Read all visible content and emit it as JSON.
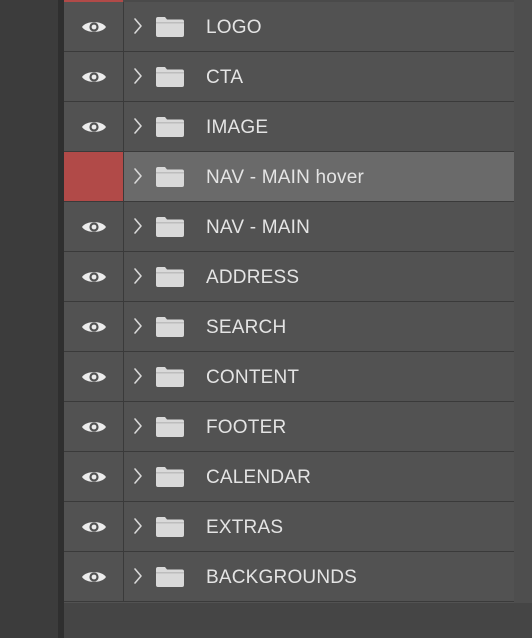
{
  "colors": {
    "panel_bg": "#525252",
    "selected_bg": "#6a6a6a",
    "hidden_marker": "#b14a48",
    "text": "#e4e4e4",
    "divider": "#3a3a3a"
  },
  "layers": [
    {
      "name": "LOGO",
      "visible": true,
      "selected": false,
      "icon": "folder-icon"
    },
    {
      "name": "CTA",
      "visible": true,
      "selected": false,
      "icon": "folder-icon"
    },
    {
      "name": "IMAGE",
      "visible": true,
      "selected": false,
      "icon": "folder-icon"
    },
    {
      "name": "NAV - MAIN hover",
      "visible": false,
      "selected": true,
      "icon": "folder-icon"
    },
    {
      "name": "NAV - MAIN",
      "visible": true,
      "selected": false,
      "icon": "folder-icon"
    },
    {
      "name": "ADDRESS",
      "visible": true,
      "selected": false,
      "icon": "folder-icon"
    },
    {
      "name": "SEARCH",
      "visible": true,
      "selected": false,
      "icon": "folder-icon"
    },
    {
      "name": "CONTENT",
      "visible": true,
      "selected": false,
      "icon": "folder-icon"
    },
    {
      "name": "FOOTER",
      "visible": true,
      "selected": false,
      "icon": "folder-icon"
    },
    {
      "name": "CALENDAR",
      "visible": true,
      "selected": false,
      "icon": "folder-icon"
    },
    {
      "name": "EXTRAS",
      "visible": true,
      "selected": false,
      "icon": "folder-icon"
    },
    {
      "name": "BACKGROUNDS",
      "visible": true,
      "selected": false,
      "icon": "folder-icon"
    }
  ]
}
